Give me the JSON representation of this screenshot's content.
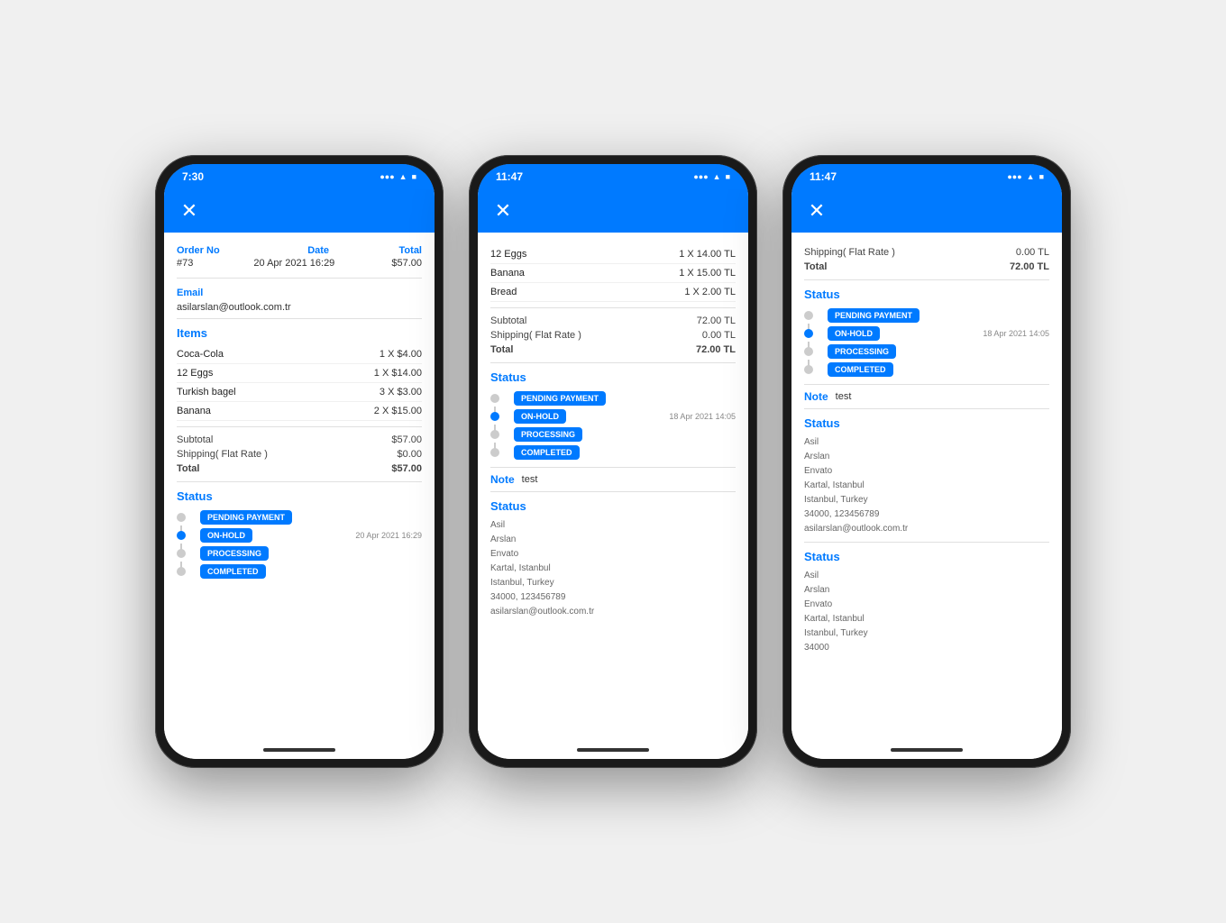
{
  "phones": [
    {
      "id": "phone1",
      "statusBar": {
        "time": "7:30",
        "icons": "● ● ● ▲ ■"
      },
      "header": {
        "closeLabel": "✕"
      },
      "orderMeta": {
        "orderNoLabel": "Order No",
        "dateLabel": "Date",
        "totalLabel": "Total",
        "orderNo": "#73",
        "date": "20 Apr 2021 16:29",
        "total": "$57.00"
      },
      "emailLabel": "Email",
      "email": "asilarslan@outlook.com.tr",
      "itemsLabel": "Items",
      "items": [
        {
          "name": "Coca-Cola",
          "qty": "1 X $4.00"
        },
        {
          "name": "12 Eggs",
          "qty": "1 X $14.00"
        },
        {
          "name": "Turkish bagel",
          "qty": "3 X $3.00"
        },
        {
          "name": "Banana",
          "qty": "2 X $15.00"
        }
      ],
      "subtotalLabel": "Subtotal",
      "subtotalValue": "$57.00",
      "shippingLabel": "Shipping( Flat Rate )",
      "shippingValue": "$0.00",
      "totalLabel2": "Total",
      "totalValue": "$57.00",
      "statusLabel": "Status",
      "timeline": [
        {
          "label": "PENDING PAYMENT",
          "active": false,
          "timestamp": ""
        },
        {
          "label": "ON-HOLD",
          "active": true,
          "timestamp": "20 Apr 2021 16:29"
        },
        {
          "label": "PROCESSING",
          "active": false,
          "timestamp": ""
        },
        {
          "label": "COMPLETED",
          "active": false,
          "timestamp": ""
        }
      ]
    },
    {
      "id": "phone2",
      "statusBar": {
        "time": "11:47",
        "icons": "● ● ● ▲ ■"
      },
      "header": {
        "closeLabel": "✕"
      },
      "showShippingTop": false,
      "items": [
        {
          "name": "12 Eggs",
          "qty": "1 X 14.00 TL"
        },
        {
          "name": "Banana",
          "qty": "1 X 15.00 TL"
        },
        {
          "name": "Bread",
          "qty": "1 X 2.00 TL"
        }
      ],
      "subtotalLabel": "Subtotal",
      "subtotalValue": "72.00 TL",
      "shippingLabel": "Shipping( Flat Rate )",
      "shippingValue": "0.00 TL",
      "totalLabel2": "Total",
      "totalValue": "72.00 TL",
      "statusLabel": "Status",
      "timeline": [
        {
          "label": "PENDING PAYMENT",
          "active": false,
          "timestamp": ""
        },
        {
          "label": "ON-HOLD",
          "active": true,
          "timestamp": "18 Apr 2021 14:05"
        },
        {
          "label": "PROCESSING",
          "active": false,
          "timestamp": ""
        },
        {
          "label": "COMPLETED",
          "active": false,
          "timestamp": ""
        }
      ],
      "noteLabel": "Note",
      "noteValue": "test",
      "statusLabel2": "Status",
      "address": [
        "Asil",
        "Arslan",
        "Envato",
        "Kartal, Istanbul",
        "Istanbul, Turkey",
        "34000, 123456789",
        "asilarslan@outlook.com.tr"
      ]
    },
    {
      "id": "phone3",
      "statusBar": {
        "time": "11:47",
        "icons": "● ● ● ▲ ■"
      },
      "header": {
        "closeLabel": "✕"
      },
      "showShippingTop": true,
      "shippingTopLabel": "Shipping( Flat Rate )",
      "shippingTopValue": "0.00 TL",
      "totalTopLabel": "Total",
      "totalTopValue": "72.00 TL",
      "statusLabel": "Status",
      "timeline": [
        {
          "label": "PENDING PAYMENT",
          "active": false,
          "timestamp": ""
        },
        {
          "label": "ON-HOLD",
          "active": true,
          "timestamp": "18 Apr 2021 14:05"
        },
        {
          "label": "PROCESSING",
          "active": false,
          "timestamp": ""
        },
        {
          "label": "COMPLETED",
          "active": false,
          "timestamp": ""
        }
      ],
      "noteLabel": "Note",
      "noteValue": "test",
      "statusLabel2": "Status",
      "address1": [
        "Asil",
        "Arslan",
        "Envato",
        "Kartal, Istanbul",
        "Istanbul, Turkey",
        "34000, 123456789",
        "asilarslan@outlook.com.tr"
      ],
      "statusLabel3": "Status",
      "address2": [
        "Asil",
        "Arslan",
        "Envato",
        "Kartal, Istanbul",
        "Istanbul, Turkey",
        "34000"
      ]
    }
  ]
}
